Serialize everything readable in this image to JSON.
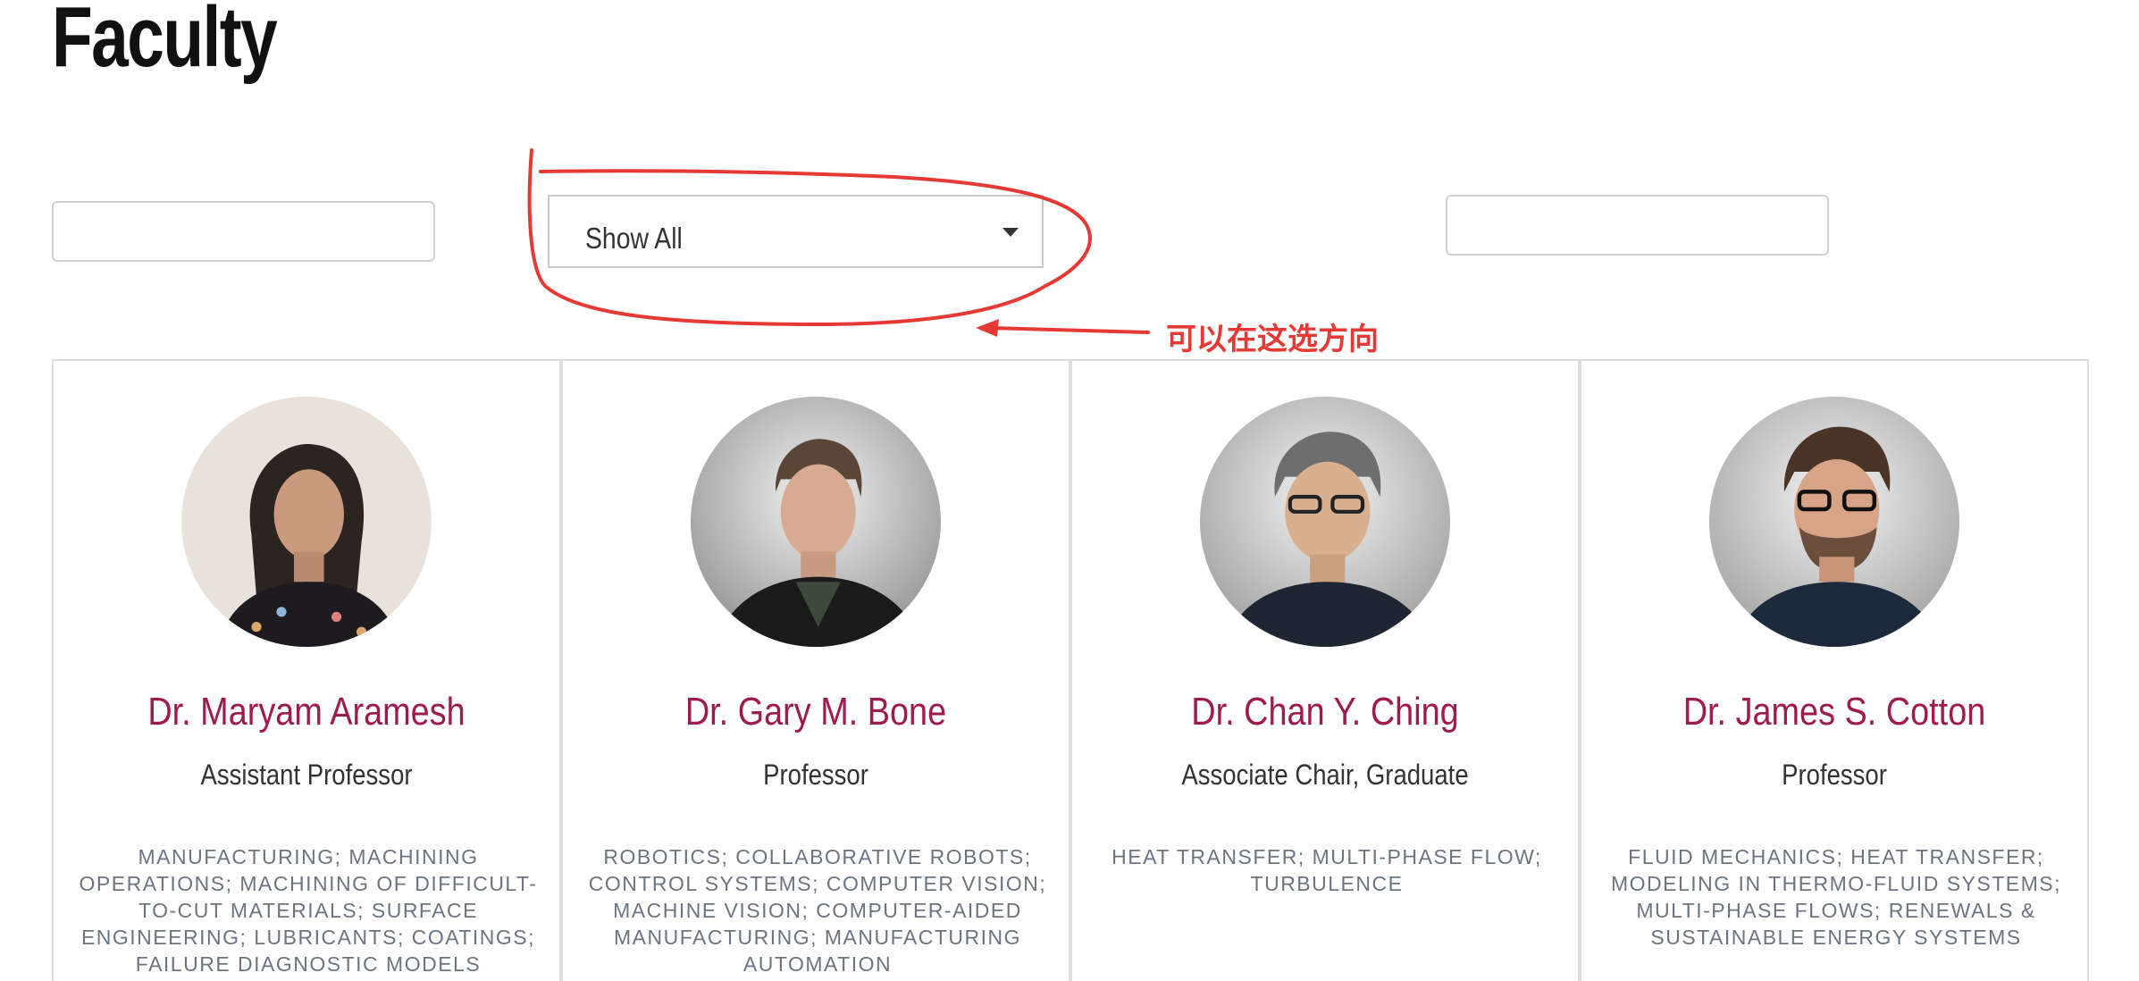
{
  "page": {
    "title": "Faculty"
  },
  "filters": {
    "search_left_value": "",
    "direction_select": {
      "selected": "Show All"
    },
    "search_right_value": ""
  },
  "annotation": {
    "note": "可以在这选方向",
    "color": "#e53935"
  },
  "colors": {
    "name_accent": "#9e1b4f",
    "areas_text": "#6b7480"
  },
  "faculty": [
    {
      "name": "Dr. Maryam Aramesh",
      "title": "Assistant Professor",
      "areas": "MANUFACTURING; MACHINING OPERATIONS; MACHINING OF DIFFICULT-TO-CUT MATERIALS; SURFACE ENGINEERING; LUBRICANTS; COATINGS; FAILURE DIAGNOSTIC MODELS",
      "photo_icon": "portrait-photo"
    },
    {
      "name": "Dr. Gary M. Bone",
      "title": "Professor",
      "areas": "ROBOTICS; COLLABORATIVE ROBOTS; CONTROL SYSTEMS; COMPUTER VISION; MACHINE VISION; COMPUTER-AIDED MANUFACTURING; MANUFACTURING AUTOMATION",
      "photo_icon": "portrait-photo"
    },
    {
      "name": "Dr. Chan Y. Ching",
      "title": "Associate Chair, Graduate",
      "areas": "HEAT TRANSFER; MULTI-PHASE FLOW; TURBULENCE",
      "photo_icon": "portrait-photo"
    },
    {
      "name": "Dr. James S. Cotton",
      "title": "Professor",
      "areas": "FLUID MECHANICS; HEAT TRANSFER; MODELING IN THERMO-FLUID SYSTEMS; MULTI-PHASE FLOWS; RENEWALS & SUSTAINABLE ENERGY SYSTEMS",
      "photo_icon": "portrait-photo"
    }
  ]
}
